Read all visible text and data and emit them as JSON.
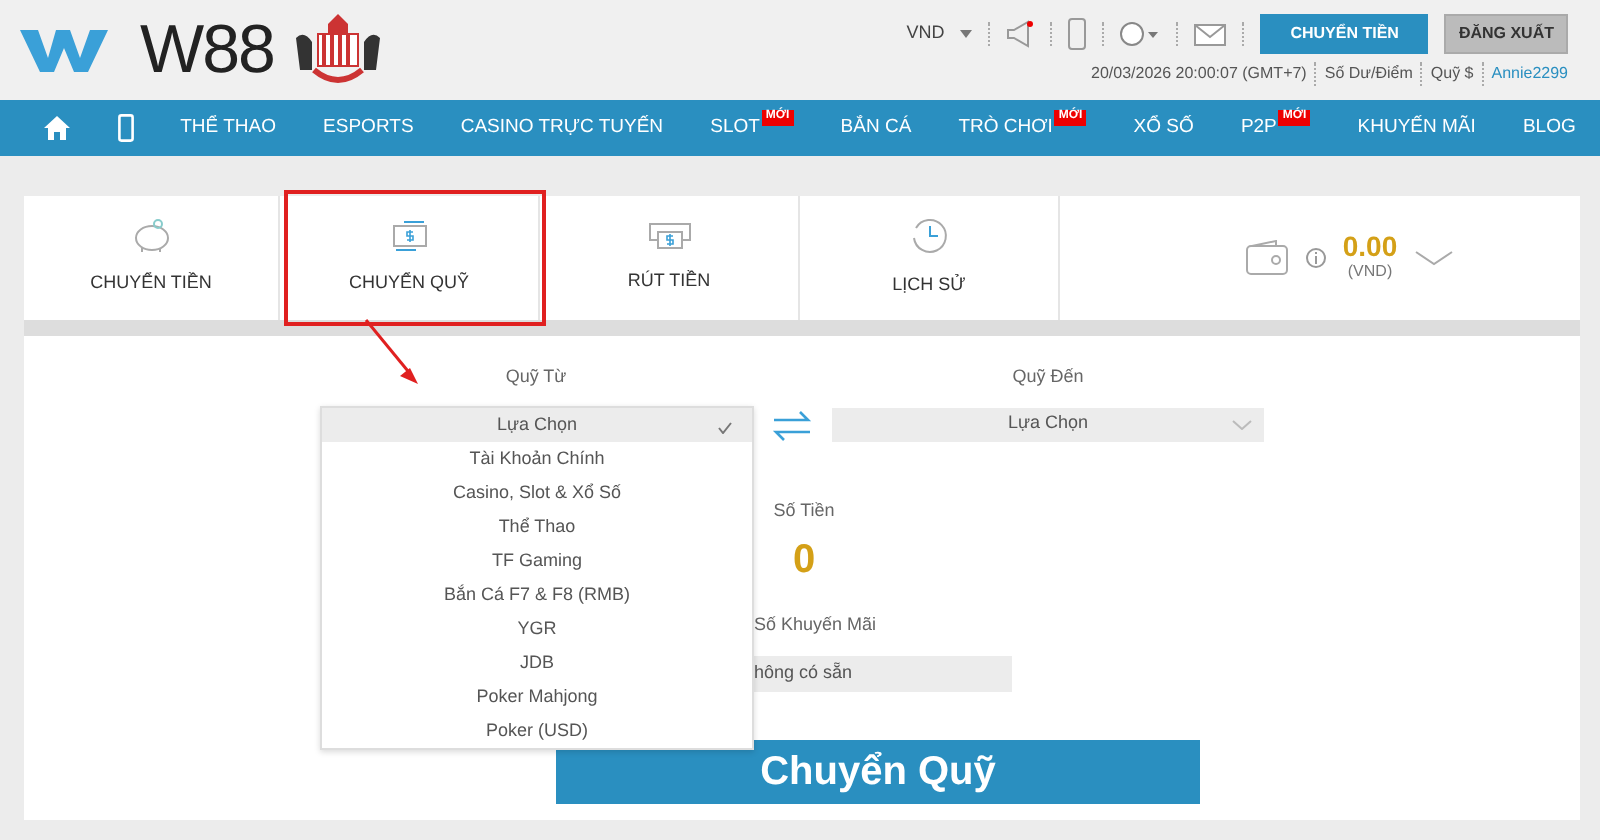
{
  "header": {
    "brand": "W88",
    "currency": "VND",
    "deposit_button": "CHUYỂN TIỀN",
    "logout_button": "ĐĂNG XUẤT",
    "datetime": "20/03/2026 20:00:07 (GMT+7)",
    "balance_link": "Số Dư/Điểm",
    "fund_link": "Quỹ $",
    "username": "Annie2299"
  },
  "nav": [
    {
      "kind": "icon"
    },
    {
      "kind": "icon"
    },
    {
      "kind": "text",
      "label": "THỂ THAO"
    },
    {
      "kind": "text",
      "label": "ESPORTS"
    },
    {
      "kind": "text",
      "label": "CASINO TRỰC TUYẾN"
    },
    {
      "kind": "text",
      "label": "SLOT",
      "badge": "MỚI"
    },
    {
      "kind": "text",
      "label": "BẮN CÁ"
    },
    {
      "kind": "text",
      "label": "TRÒ CHƠI",
      "badge": "MỚI"
    },
    {
      "kind": "text",
      "label": "XỔ SỐ"
    },
    {
      "kind": "text",
      "label": "P2P",
      "badge": "MỚI"
    },
    {
      "kind": "text",
      "label": "KHUYẾN MÃI"
    },
    {
      "kind": "text",
      "label": "BLOG"
    }
  ],
  "tabs": [
    {
      "label": "CHUYỂN TIỀN",
      "highlighted": false
    },
    {
      "label": "CHUYỂN QUỸ",
      "highlighted": true
    },
    {
      "label": "RÚT TIỀN",
      "highlighted": false
    },
    {
      "label": "LỊCH SỬ",
      "highlighted": false
    }
  ],
  "wallet": {
    "amount": "0.00",
    "currency": "(VND)"
  },
  "form": {
    "from_label": "Quỹ Từ",
    "to_label": "Quỹ Đến",
    "to_select": "Lựa Chọn",
    "from_options": [
      {
        "label": "Lựa Chọn",
        "selected": true
      },
      {
        "label": "Tài Khoản Chính",
        "selected": false
      },
      {
        "label": "Casino, Slot & Xổ Số",
        "selected": false
      },
      {
        "label": "Thể Thao",
        "selected": false
      },
      {
        "label": "TF Gaming",
        "selected": false
      },
      {
        "label": "Bắn Cá F7 & F8 (RMB)",
        "selected": false
      },
      {
        "label": "YGR",
        "selected": false
      },
      {
        "label": "JDB",
        "selected": false
      },
      {
        "label": "Poker Mahjong",
        "selected": false
      },
      {
        "label": "Poker (USD)",
        "selected": false
      }
    ],
    "amount_label": "Số Tiền",
    "amount": "0",
    "promo_label": "Số Khuyến Mãi",
    "promo_value": "hông có sẵn",
    "submit": "Chuyển Quỹ"
  }
}
